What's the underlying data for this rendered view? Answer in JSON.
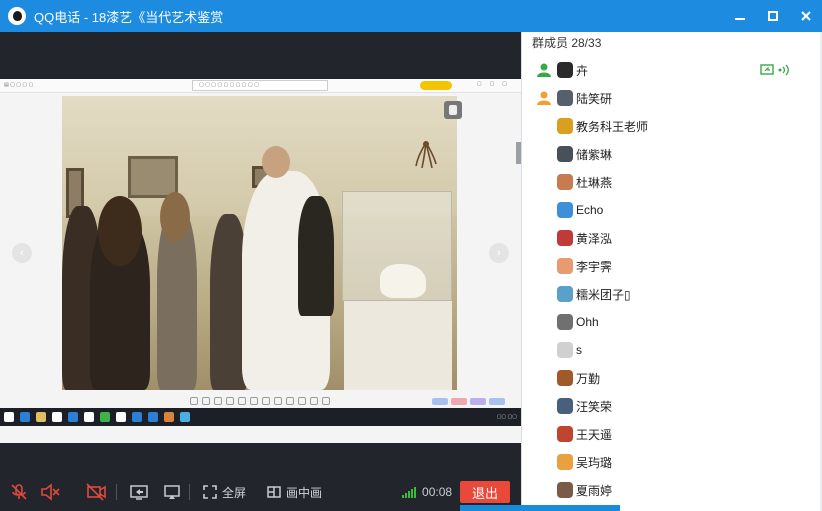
{
  "window": {
    "title": "QQ电话 - 18漆艺《当代艺术鉴赏",
    "minimize_icon": "minimize-icon",
    "maximize_icon": "maximize-icon",
    "close_icon": "close-icon"
  },
  "shared_screen": {
    "prev_icon": "chevron-left-icon",
    "next_icon": "chevron-right-icon"
  },
  "controls": {
    "icons": [
      "mic-muted-icon",
      "speaker-muted-icon",
      "camera-off-icon",
      "screen-share-icon",
      "cast-icon",
      "fullscreen-icon",
      "picture-in-picture-icon",
      "signal-icon"
    ],
    "fullscreen_label": "全屏",
    "pip_label": "画中画",
    "timer": "00:08",
    "exit_label": "退出",
    "exit_color": "#e9493b",
    "signal_color": "#3dbb3a"
  },
  "members": {
    "header": "群成员 28/33",
    "list": [
      {
        "name": "卉",
        "host": true,
        "status": [
          "screen-share-icon",
          "speaking-icon"
        ]
      },
      {
        "name": "陆笑研",
        "host": true
      },
      {
        "name": "教务科王老师",
        "host": false
      },
      {
        "name": "储紫琳",
        "host": false
      },
      {
        "name": "杜琳燕",
        "host": false
      },
      {
        "name": "Echo",
        "host": false
      },
      {
        "name": "黄泽泓",
        "host": false
      },
      {
        "name": "李宇霁",
        "host": false
      },
      {
        "name": "糯米团子▯",
        "host": false
      },
      {
        "name": "Ohh",
        "host": false
      },
      {
        "name": "s",
        "host": false
      },
      {
        "name": "万勤",
        "host": false
      },
      {
        "name": "汪笑荣",
        "host": false
      },
      {
        "name": "王天遥",
        "host": false
      },
      {
        "name": "吴玙璐",
        "host": false
      },
      {
        "name": "夏雨婷",
        "host": false
      }
    ],
    "host_icon_color": "#f0a030"
  }
}
